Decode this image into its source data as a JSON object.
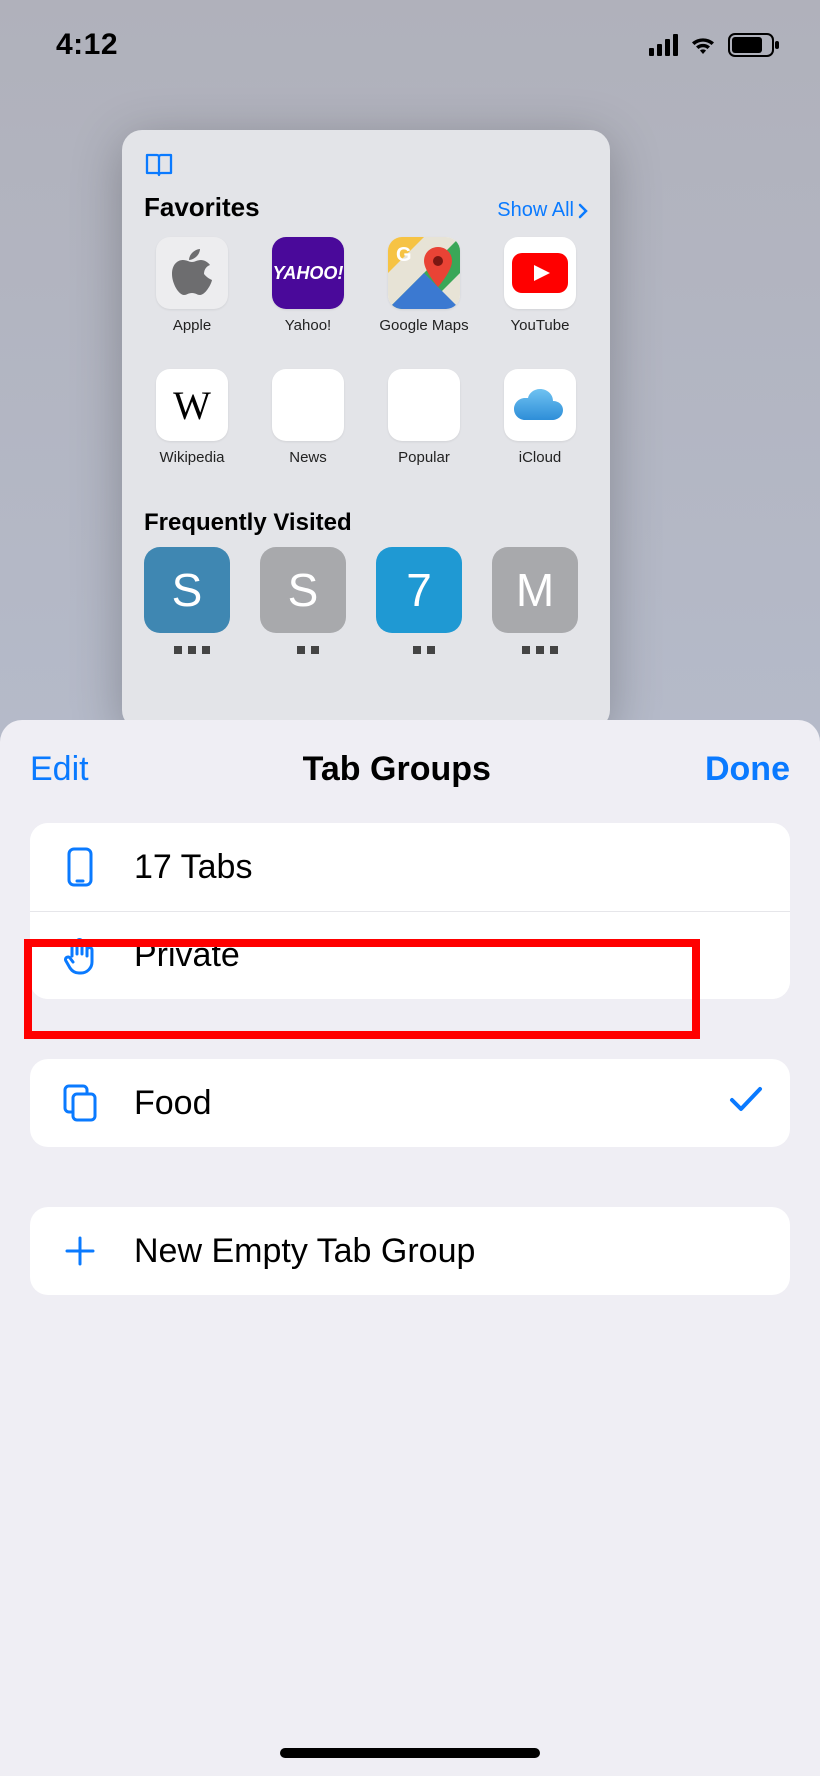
{
  "status": {
    "time": "4:12"
  },
  "start_page": {
    "favorites_title": "Favorites",
    "show_all": "Show All",
    "favorites": [
      {
        "label": "Apple"
      },
      {
        "label": "Yahoo!"
      },
      {
        "label": "Google Maps"
      },
      {
        "label": "YouTube"
      },
      {
        "label": "Wikipedia"
      },
      {
        "label": "News"
      },
      {
        "label": "Popular"
      },
      {
        "label": "iCloud"
      }
    ],
    "frequently_title": "Frequently Visited",
    "frequently": [
      {
        "letter": "S",
        "color": "#3f87b2"
      },
      {
        "letter": "S",
        "color": "#a8a9ac"
      },
      {
        "letter": "7",
        "color": "#1f99d3"
      },
      {
        "letter": "M",
        "color": "#a8a9ac"
      }
    ]
  },
  "sheet": {
    "edit": "Edit",
    "title": "Tab Groups",
    "done": "Done",
    "rows": {
      "tabs": "17 Tabs",
      "private": "Private",
      "group1": "Food",
      "new": "New Empty Tab Group"
    }
  }
}
